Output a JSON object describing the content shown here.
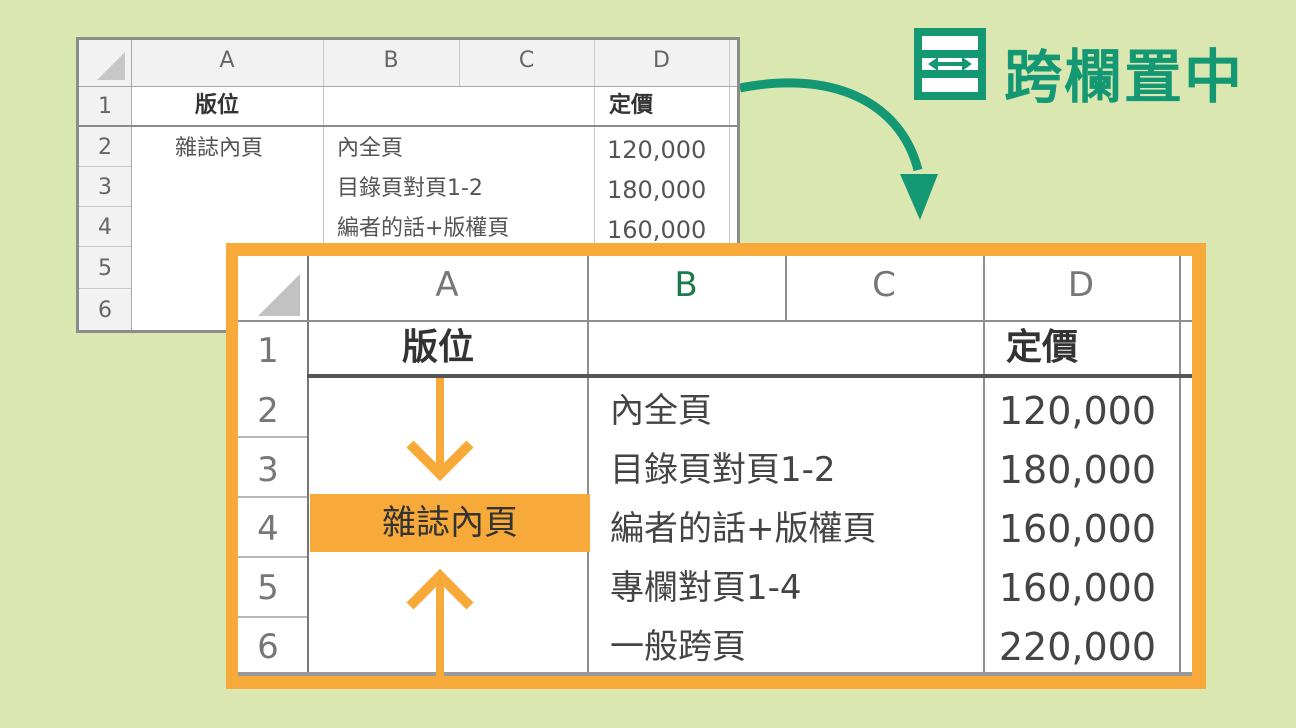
{
  "title": {
    "label": "跨欄置中",
    "icon": "merge-center-icon",
    "color": "#139873"
  },
  "accent_color": "#f7a93a",
  "columns": [
    "A",
    "B",
    "C",
    "D"
  ],
  "row_numbers": [
    "1",
    "2",
    "3",
    "4",
    "5",
    "6"
  ],
  "before_sheet": {
    "row1": {
      "a": "版位",
      "d": "定價"
    },
    "rows": [
      {
        "a": "雜誌內頁",
        "b": "內全頁",
        "d": "120,000"
      },
      {
        "a": "",
        "b": "目錄頁對頁1-2",
        "d": "180,000"
      },
      {
        "a": "",
        "b": "編者的話+版權頁",
        "d": "160,000"
      }
    ]
  },
  "after_sheet": {
    "row1": {
      "a": "版位",
      "d": "定價"
    },
    "merged_cell": "雜誌內頁",
    "rows": [
      {
        "b": "內全頁",
        "d": "120,000"
      },
      {
        "b": "目錄頁對頁1-2",
        "d": "180,000"
      },
      {
        "b": "編者的話+版權頁",
        "d": "160,000"
      },
      {
        "b": "專欄對頁1-4",
        "d": "160,000"
      },
      {
        "b": "一般跨頁",
        "d": "220,000"
      }
    ]
  },
  "icons": {
    "curved_arrow": "curved-arrow-icon",
    "down_arrow": "down-arrow-icon",
    "up_arrow": "up-arrow-icon"
  }
}
